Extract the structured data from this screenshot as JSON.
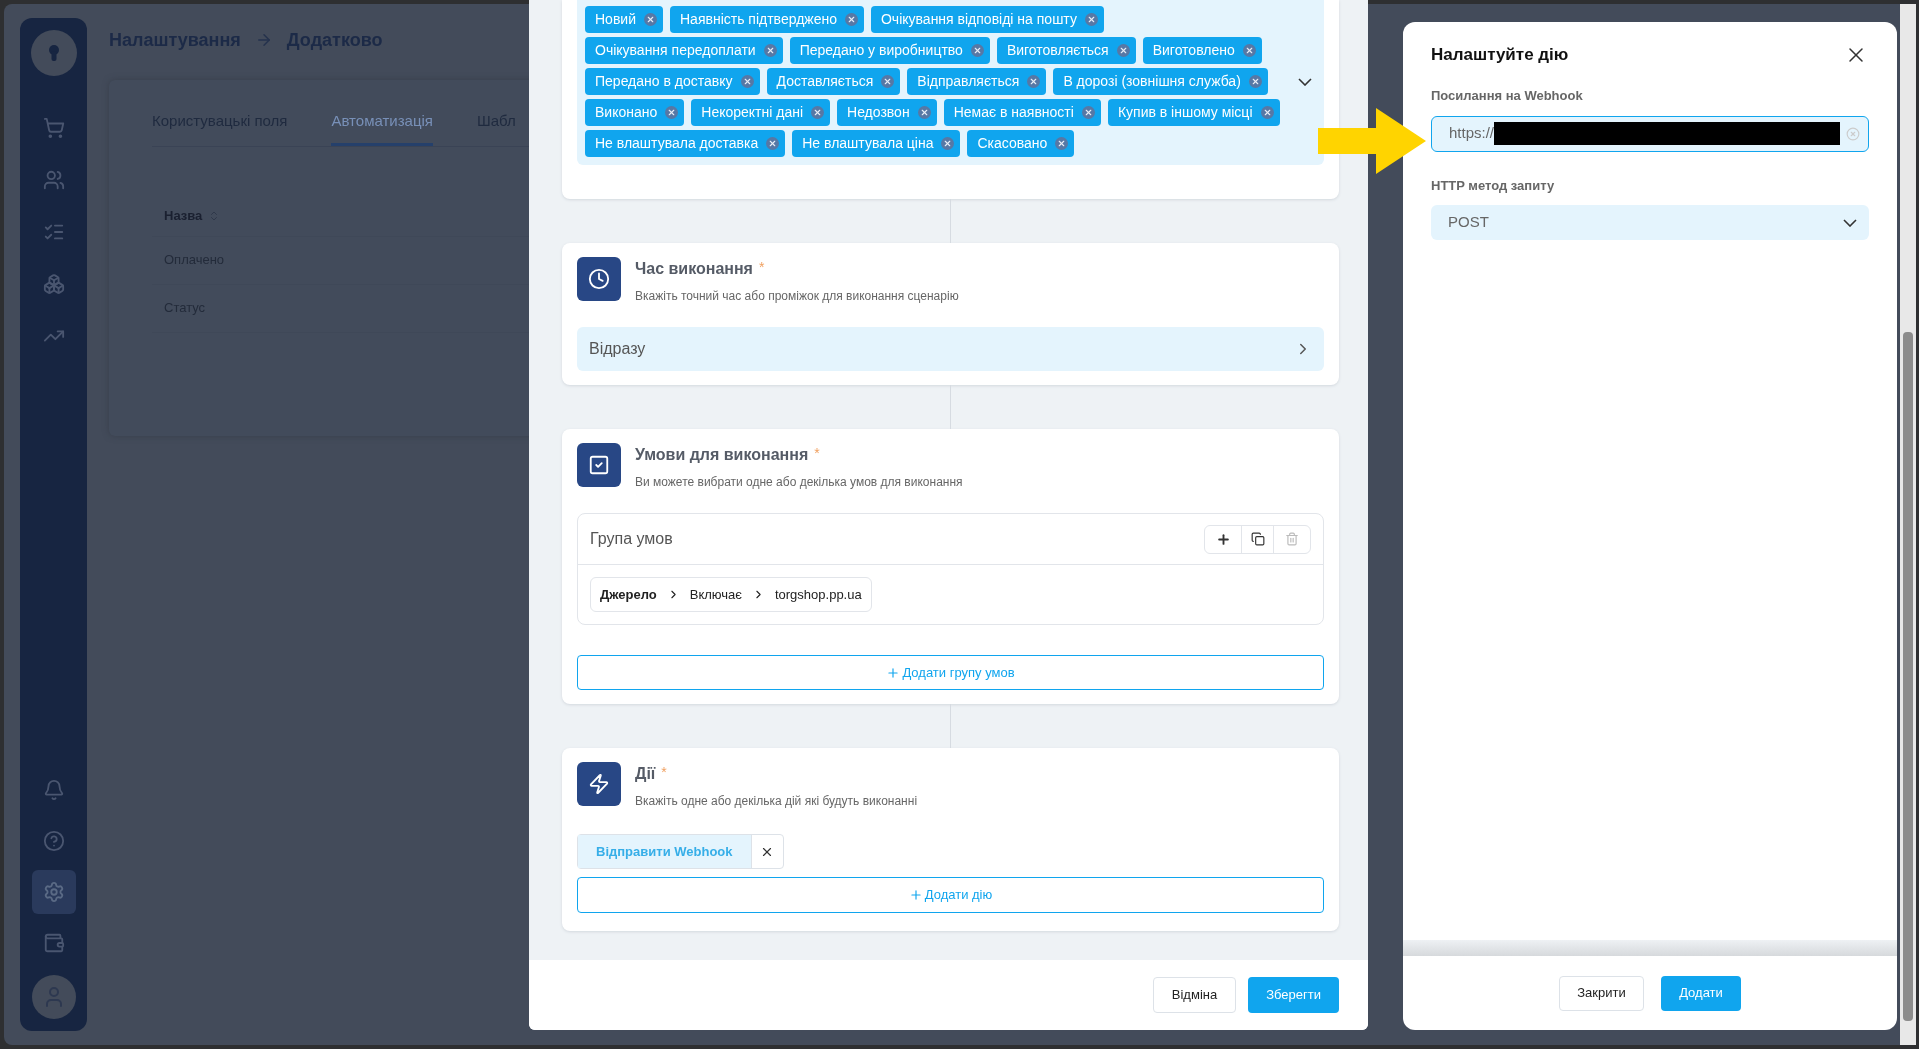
{
  "breadcrumb": {
    "items": [
      "Налаштування",
      "Додатково"
    ]
  },
  "sidebar": {
    "top_items": [
      {
        "kind": "cart",
        "selected": false
      },
      {
        "kind": "clients",
        "selected": false
      },
      {
        "kind": "tasks",
        "selected": false
      },
      {
        "kind": "warehouse",
        "selected": false
      },
      {
        "kind": "analytics",
        "selected": false
      }
    ],
    "bottom_items": [
      {
        "kind": "notifications",
        "selected": false
      },
      {
        "kind": "help",
        "selected": false
      },
      {
        "kind": "settings",
        "selected": true
      },
      {
        "kind": "wallet",
        "selected": false
      }
    ]
  },
  "page": {
    "tabs": [
      {
        "label": "Користувацькі поля",
        "selected": false
      },
      {
        "label": "Автоматизація",
        "selected": true
      },
      {
        "label": "Шабл",
        "selected": false
      }
    ],
    "table": {
      "columns": [
        "Назва"
      ],
      "rows": [
        [
          "Оплачено"
        ],
        [
          "Статус"
        ]
      ]
    }
  },
  "scenario_editor": {
    "status_tags": [
      "Новий",
      "Наявність підтверджено",
      "Очікування відповіді на пошту",
      "Очікування передоплати",
      "Передано у виробництво",
      "Виготовляється",
      "Виготовлено",
      "Передано в доставку",
      "Доставляється",
      "Відправляється",
      "В дорозі (зовнішня служба)",
      "Виконано",
      "Некоректні дані",
      "Недозвон",
      "Немає в наявності",
      "Купив в іншому місці",
      "Не влаштувала доставка",
      "Не влаштувала ціна",
      "Скасовано"
    ],
    "sections": [
      {
        "kind": "time",
        "title": "Час виконання",
        "required_mark": "*",
        "hint": "Вкажіть точний час або проміжок для виконання сценарію",
        "value": "Відразу"
      },
      {
        "kind": "conditions",
        "title": "Умови для виконання",
        "required_mark": "*",
        "hint": "Ви можете вибрати одне або декілька умов для виконання",
        "group": {
          "title": "Група умов",
          "condition": {
            "field": "Джерело",
            "operator": "Включає",
            "value": "torgshop.pp.ua"
          }
        },
        "add_button": "Додати групу умов"
      },
      {
        "kind": "actions",
        "title": "Дії",
        "required_mark": "*",
        "hint": "Вкажіть одне або декілька дій які будуть виконанні",
        "actions": [
          "Відправити Webhook"
        ],
        "add_button": "Додати дію"
      }
    ],
    "buttons": {
      "cancel": "Відміна",
      "save": "Зберегти"
    }
  },
  "action_dialog": {
    "title": "Налаштуйте дію",
    "fields": [
      {
        "kind": "text",
        "label": "Посилання на Webhook",
        "value": "https://",
        "redacted": true,
        "focused": true
      },
      {
        "kind": "select",
        "label": "HTTP метод запиту",
        "value": "POST"
      }
    ],
    "buttons": {
      "close": "Закрити",
      "add": "Додати"
    }
  }
}
